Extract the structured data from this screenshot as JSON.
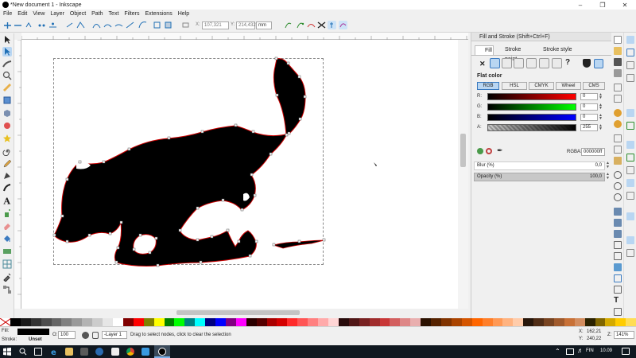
{
  "window": {
    "title": "*New document 1 - Inkscape"
  },
  "menu": [
    "File",
    "Edit",
    "View",
    "Layer",
    "Object",
    "Path",
    "Text",
    "Filters",
    "Extensions",
    "Help"
  ],
  "controls": {
    "x_label": "X:",
    "x_value": "107,321",
    "y_label": "Y:",
    "y_value": "214,432",
    "unit": "mm"
  },
  "dock": {
    "title": "Fill and Stroke (Shift+Ctrl+F)",
    "tabs": [
      "Fill",
      "Stroke paint",
      "Stroke style"
    ],
    "paint_type_label": "Flat color",
    "color_modes": [
      "RGB",
      "HSL",
      "CMYK",
      "Wheel",
      "CMS"
    ],
    "channels": [
      {
        "label": "R:",
        "value": "0"
      },
      {
        "label": "G:",
        "value": "0"
      },
      {
        "label": "B:",
        "value": "0"
      },
      {
        "label": "A:",
        "value": "255"
      }
    ],
    "rgba_label": "RGBA:",
    "rgba_value": "000000ff",
    "blur_label": "Blur (%)",
    "blur_value": "0,0",
    "opacity_label": "Opacity (%)",
    "opacity_value": "100,0"
  },
  "status": {
    "fill_label": "Fill:",
    "stroke_label": "Stroke:",
    "stroke_value": "Unset",
    "opacity_label": "O:",
    "opacity_value": "100",
    "layer": "-Layer 1",
    "message": "Drag to select nodes, click to clear the selection",
    "x_label": "X:",
    "x_value": "162,21",
    "y_label": "Y:",
    "y_value": "240,22",
    "zoom_label": "Z:",
    "zoom_value": "141%"
  },
  "taskbar": {
    "lang": "FIN",
    "time": "10.09"
  },
  "colors": {
    "accent": "#3399ff",
    "path_stroke": "#cc0000",
    "shape_fill": "#000000"
  }
}
